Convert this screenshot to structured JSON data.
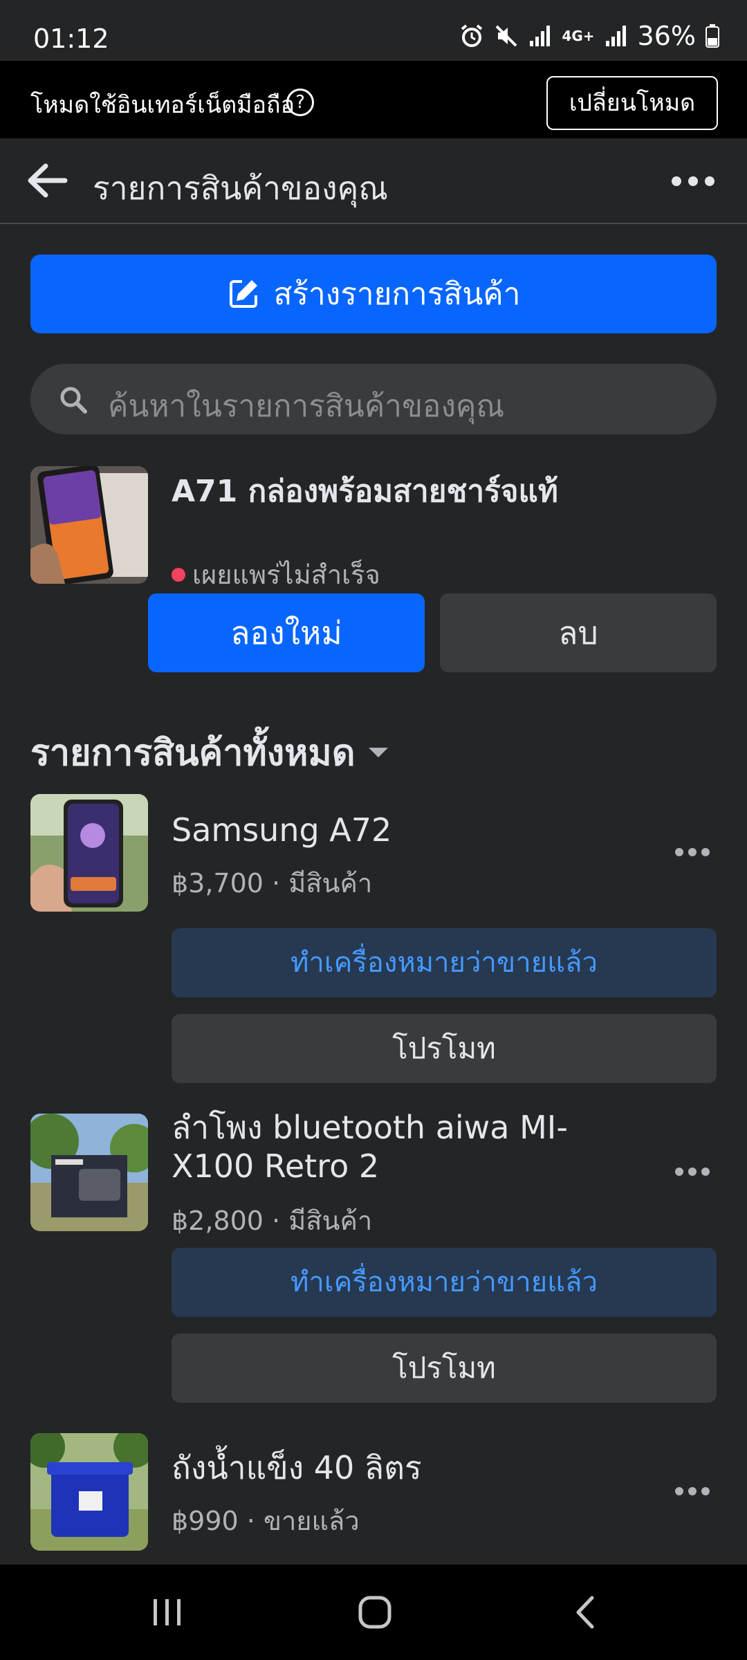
{
  "status_bar": {
    "time": "01:12",
    "network": "4G+",
    "battery": "36%",
    "icons": [
      "alarm-icon",
      "mute-icon",
      "signal-icon",
      "battery-icon"
    ]
  },
  "mode_bar": {
    "label": "โหมดใช้อินเทอร์เน็ตมือถือ",
    "help": "?",
    "switch_label": "เปลี่ยนโหมด"
  },
  "header": {
    "title": "รายการสินค้าของคุณ"
  },
  "create_button": {
    "label": "สร้างรายการสินค้า"
  },
  "search": {
    "placeholder": "ค้นหาในรายการสินค้าของคุณ"
  },
  "failed_listing": {
    "title": "A71 กล่องพร้อมสายชาร์จแท้",
    "status": "เผยแพร่ไม่สำเร็จ",
    "status_color": "#f3425f",
    "retry_label": "ลองใหม่",
    "delete_label": "ลบ"
  },
  "section": {
    "title": "รายการสินค้าทั้งหมด"
  },
  "listings": [
    {
      "title": "Samsung A72",
      "price": "฿3,700",
      "status": "มีสินค้า",
      "mark_sold_label": "ทำเครื่องหมายว่าขายแล้ว",
      "promote_label": "โปรโมท"
    },
    {
      "title": "ลำโพง bluetooth aiwa MI-X100 Retro 2",
      "price": "฿2,800",
      "status": "มีสินค้า",
      "mark_sold_label": "ทำเครื่องหมายว่าขายแล้ว",
      "promote_label": "โปรโมท"
    },
    {
      "title": "ถังน้ำแข็ง 40 ลิตร",
      "price": "฿990",
      "status": "ขายแล้ว"
    }
  ],
  "colors": {
    "background": "#242526",
    "primary": "#0866ff",
    "secondary_button": "#3a3b3c",
    "mark_sold_bg": "#263951",
    "mark_sold_text": "#4599ff"
  }
}
